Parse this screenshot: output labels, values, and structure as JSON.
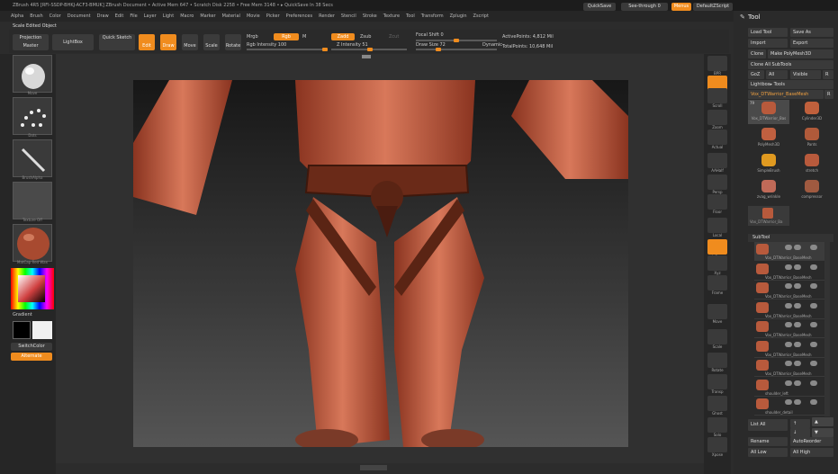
{
  "app": {
    "title": "ZBrush 4R5 [RFI-SSDP-BHKJ-ACF3-BMUK]   ZBrush Document   • Active Mem 647 • Scratch Disk 2258 • Free Mem 3148 • ▸ QuickSave In 38 Secs",
    "quicksave": "QuickSave",
    "seethrough": "See-through   0",
    "menus_btn": "Menus",
    "default_script": "DefaultZScript"
  },
  "menubar": [
    "Alpha",
    "Brush",
    "Color",
    "Document",
    "Draw",
    "Edit",
    "File",
    "Layer",
    "Light",
    "Macro",
    "Marker",
    "Material",
    "Movie",
    "Picker",
    "Preferences",
    "Render",
    "Stencil",
    "Stroke",
    "Texture",
    "Tool",
    "Transform",
    "Zplugin",
    "Zscript"
  ],
  "shelf": {
    "scale_label": "Scale Edited Object",
    "projection_master": "Projection Master",
    "lightbox": "LightBox",
    "quick_sketch": "Quick Sketch",
    "edit": "Edit",
    "draw": "Draw",
    "move": "Move",
    "scale": "Scale",
    "rotate": "Rotate",
    "mrgb": "Mrgb",
    "rgb": "Rgb",
    "m": "M",
    "rgb_intensity": "Rgb Intensity 100",
    "zadd": "Zadd",
    "zsub": "Zsub",
    "zcut": "Zcut",
    "z_intensity": "Z Intensity 51",
    "focal_shift": "Focal Shift 0",
    "draw_size": "Draw Size 72",
    "dynamic": "Dynamic",
    "active_points": "ActivePoints: 4,812 Mil",
    "total_points": "TotalPoints: 10,648 Mil"
  },
  "left": {
    "brush_cap": "Move",
    "stroke_cap": "Dots",
    "alpha_cap": "BrushAlpha",
    "texture_cap": "Texture Off",
    "material_cap": "MatCap Red Wax",
    "gradient": "Gradient",
    "switchcolor": "SwitchColor",
    "alternate": "Alternate",
    "main_color": "#f0f0f0",
    "secondary_color": "#000000"
  },
  "rightstrip": [
    "BPR",
    "SPix 3",
    "Scroll",
    "Zoom",
    "Actual",
    "AAHalf",
    "Persp",
    "Floor",
    "Local",
    "L.Sym",
    "Xyz",
    "Frame",
    "Move",
    "Scale",
    "Rotate",
    "Transp",
    "Ghost",
    "Solo",
    "Xpose"
  ],
  "tool": {
    "title": "Tool",
    "load_tool": "Load Tool",
    "save_as": "Save As",
    "import": "Import",
    "export": "Export",
    "clone": "Clone",
    "make_polymesh": "Make PolyMesh3D",
    "clone_all": "Clone All SubTools",
    "goz": "GoZ",
    "all": "All",
    "visible": "Visible",
    "r": "R",
    "lightbox_tools": "Lightbox▸ Tools",
    "current_tool": "Vox_DTWarrior_BaseMesh",
    "current_num": "79",
    "tools": [
      {
        "name": "Vox_DTWarrior_Bas",
        "color": "#b85a3c"
      },
      {
        "name": "Cylinder3D",
        "color": "#c0603c"
      },
      {
        "name": "PolyMesh3D",
        "color": "#c06040"
      },
      {
        "name": "Pants",
        "color": "#b05a3a"
      },
      {
        "name": "SimpleBrush",
        "color": "#e09a20"
      },
      {
        "name": "stretch",
        "color": "#b85a3c"
      },
      {
        "name": "zvag_wrinkle",
        "color": "#c06a58"
      },
      {
        "name": "compressor",
        "color": "#a05a40"
      }
    ],
    "extra_tool": "Vox_DTWarrior_Ba",
    "subtool_header": "SubTool",
    "subtools": [
      "Vox_DTWarrior_BaseMesh",
      "Vox_DTWarrior_BaseMesh",
      "Vox_DTWarrior_BaseMesh",
      "Vox_DTWarrior_BaseMesh",
      "Vox_DTWarrior_BaseMesh",
      "Vox_DTWarrior_BaseMesh",
      "Vox_DTWarrior_BaseMesh",
      "shoulder_left",
      "shoulder_detail"
    ],
    "list_all": "List All",
    "rename": "Rename",
    "autoreorder": "AutoReorder",
    "all_low": "All Low",
    "all_high": "All High"
  }
}
